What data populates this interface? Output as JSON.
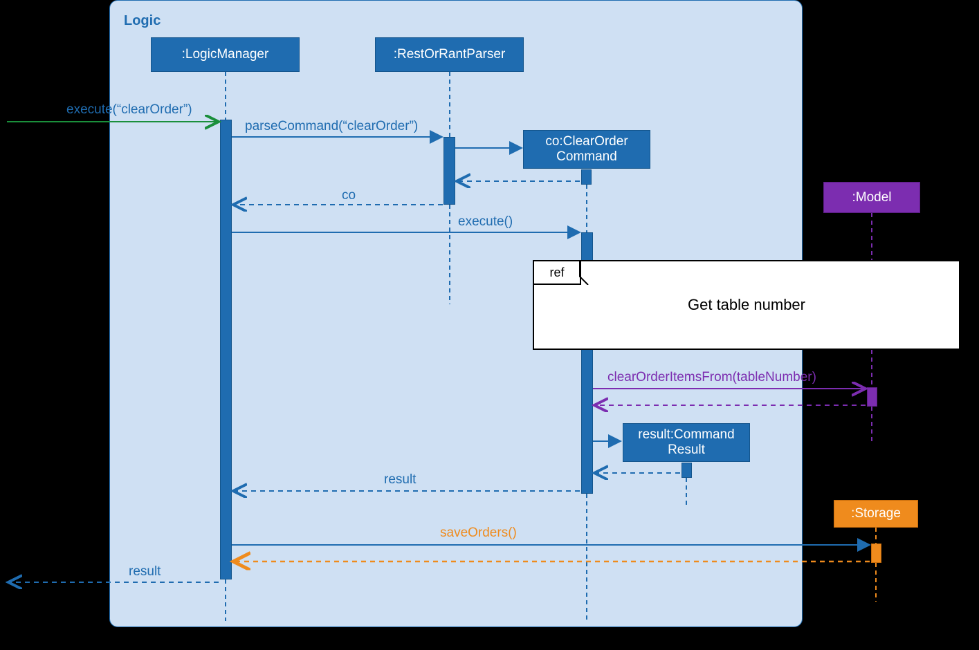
{
  "frame": {
    "label": "Logic"
  },
  "participants": {
    "logicManager": ":LogicManager",
    "parser": ":RestOrRantParser",
    "clearOrder": "co:ClearOrder Command",
    "commandResult": "result:Command Result",
    "model": ":Model",
    "storage": ":Storage"
  },
  "ref": {
    "tab": "ref",
    "title": "Get table number"
  },
  "messages": {
    "executeClearOrder": "execute(“clearOrder”)",
    "parseCommand": "parseCommand(“clearOrder”)",
    "returnCo": "co",
    "execute": "execute()",
    "clearOrderItemsFrom": "clearOrderItemsFrom(tableNumber)",
    "returnResult": "result",
    "saveOrders": "saveOrders()",
    "finalResult": "result"
  },
  "colors": {
    "blue": "#1f6cb0",
    "green": "#1a8f3b",
    "purple": "#7c2db0",
    "orange": "#ef8b1d",
    "frameBg": "#cfe0f3"
  }
}
